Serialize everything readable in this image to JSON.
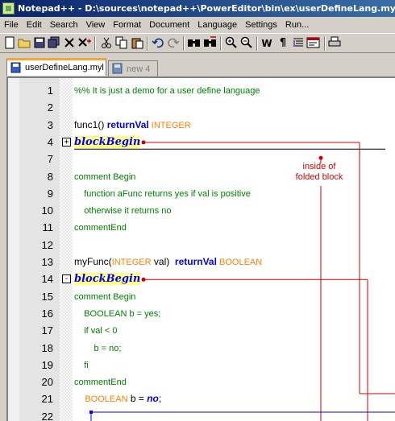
{
  "window": {
    "title": "Notepad++ - D:\\sources\\notepad++\\PowerEditor\\bin\\ex\\userDefineLang.myl"
  },
  "menu": [
    "File",
    "Edit",
    "Search",
    "View",
    "Format",
    "Document",
    "Language",
    "Settings",
    "Run..."
  ],
  "toolbar": {
    "icons": [
      "new-file-icon",
      "open-folder-icon",
      "save-icon",
      "save-all-icon",
      "close-icon",
      "close-all-icon",
      "cut-icon",
      "copy-icon",
      "paste-icon",
      "undo-icon",
      "redo-icon",
      "find-icon",
      "replace-icon",
      "zoom-in-icon",
      "zoom-out-icon",
      "wrap-icon",
      "show-all-chars-icon",
      "indent-guide-icon",
      "user-lang-icon",
      "print-icon"
    ],
    "wrap_label": "W",
    "para_glyph": "¶"
  },
  "tabs": [
    {
      "label": "userDefineLang.myl",
      "active": true
    },
    {
      "label": "new 4",
      "active": false
    }
  ],
  "editor": {
    "lines": [
      {
        "num": "1",
        "segments": [
          {
            "t": "%% It is just a demo for a user define language",
            "c": "green"
          }
        ]
      },
      {
        "num": "2",
        "segments": []
      },
      {
        "num": "3",
        "segments": [
          {
            "t": "func1() ",
            "c": "plain"
          },
          {
            "t": "returnVal",
            "c": "blue"
          },
          {
            "t": " INTEGER",
            "c": "orange"
          }
        ]
      },
      {
        "num": "4",
        "fold": "+",
        "segments": [
          {
            "t": "blockBegin",
            "c": "block"
          }
        ]
      },
      {
        "num": "7",
        "segments": []
      },
      {
        "num": "8",
        "segments": [
          {
            "t": "comment Begin",
            "c": "green"
          }
        ]
      },
      {
        "num": "9",
        "segments": [
          {
            "t": "    function aFunc returns yes if val is positive",
            "c": "green"
          }
        ]
      },
      {
        "num": "10",
        "segments": [
          {
            "t": "    otherwise it returns no",
            "c": "green"
          }
        ]
      },
      {
        "num": "11",
        "segments": [
          {
            "t": "commentEnd",
            "c": "green"
          }
        ]
      },
      {
        "num": "12",
        "segments": []
      },
      {
        "num": "13",
        "segments": [
          {
            "t": "myFunc(",
            "c": "plain"
          },
          {
            "t": "INTEGER",
            "c": "orange"
          },
          {
            "t": " val)  ",
            "c": "plain"
          },
          {
            "t": "returnVal",
            "c": "blue"
          },
          {
            "t": " BOOLEAN",
            "c": "orange"
          }
        ]
      },
      {
        "num": "14",
        "fold": "-",
        "segments": [
          {
            "t": "blockBegin",
            "c": "block"
          }
        ]
      },
      {
        "num": "15",
        "segments": [
          {
            "t": "comment Begin",
            "c": "green"
          }
        ]
      },
      {
        "num": "16",
        "segments": [
          {
            "t": "    BOOLEAN b = yes;",
            "c": "green"
          }
        ]
      },
      {
        "num": "17",
        "segments": [
          {
            "t": "    if val < 0",
            "c": "green"
          }
        ]
      },
      {
        "num": "18",
        "segments": [
          {
            "t": "        b = no;",
            "c": "green"
          }
        ]
      },
      {
        "num": "19",
        "segments": [
          {
            "t": "    fi",
            "c": "green"
          }
        ]
      },
      {
        "num": "20",
        "segments": [
          {
            "t": "commentEnd",
            "c": "green"
          }
        ]
      },
      {
        "num": "21",
        "segments": [
          {
            "t": "    ",
            "c": "plain"
          },
          {
            "t": "BOOLEAN",
            "c": "orange"
          },
          {
            "t": " b = ",
            "c": "plain"
          },
          {
            "t": "no",
            "c": "italicblue"
          },
          {
            "t": ";",
            "c": "plain"
          }
        ]
      },
      {
        "num": "22",
        "segments": []
      }
    ]
  },
  "annotation": {
    "text_line1": "inside of",
    "text_line2": "folded block"
  },
  "colors": {
    "accent_tab": "#f7a530",
    "annotation": "#d00000",
    "keyword": "#0000ff",
    "type": "#ff8000",
    "comment": "#008000"
  }
}
